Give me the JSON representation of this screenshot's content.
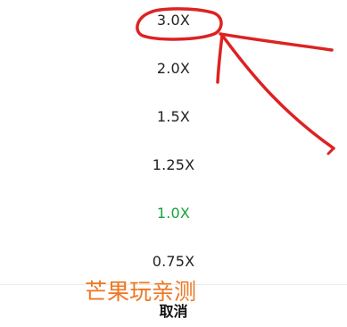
{
  "speed_sheet": {
    "options": [
      {
        "label": "3.0X",
        "selected": false
      },
      {
        "label": "2.0X",
        "selected": false
      },
      {
        "label": "1.5X",
        "selected": false
      },
      {
        "label": "1.25X",
        "selected": false
      },
      {
        "label": "1.0X",
        "selected": true
      },
      {
        "label": "0.75X",
        "selected": false
      }
    ],
    "cancel_label": "取消",
    "selected_color": "#1aa33c"
  },
  "watermark": {
    "text": "芒果玩亲测",
    "color": "#ee7722"
  },
  "annotation": {
    "color": "#dd2222",
    "marked_option": "3.0X"
  }
}
